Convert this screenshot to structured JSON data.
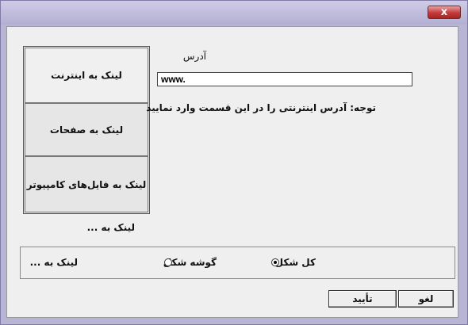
{
  "window": {
    "close_glyph": "x"
  },
  "tabs": [
    {
      "label": "لینک به اینترنت"
    },
    {
      "label": "لینک به صفحات"
    },
    {
      "label": "لینک به فایل‌های کامپیوتر"
    }
  ],
  "address": {
    "label": "آدرس",
    "value": "www."
  },
  "note": "توجه: آدرس اینترنتی را در این قسمت وارد نمایید",
  "link_to_caption": "لینک به ...",
  "shape_group": {
    "label": "لینک به ...",
    "options": [
      {
        "label": "گوشه شکل",
        "selected": false
      },
      {
        "label": "کل شکل",
        "selected": true
      }
    ]
  },
  "buttons": {
    "ok": "تأیید",
    "cancel": "لغو"
  }
}
